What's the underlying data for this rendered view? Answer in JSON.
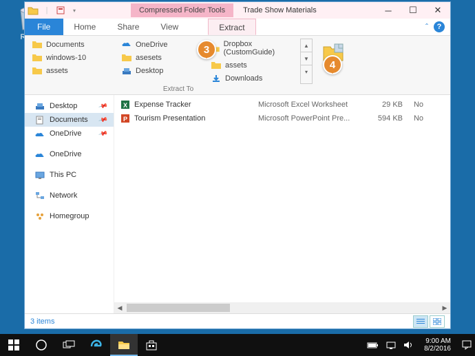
{
  "desktop": {
    "recycle_bin": "Recy"
  },
  "window": {
    "context_title": "Compressed Folder Tools",
    "title": "Trade Show Materials",
    "tabs": {
      "file": "File",
      "home": "Home",
      "share": "Share",
      "view": "View",
      "extract": "Extract"
    },
    "ribbon": {
      "destinations": [
        [
          "Documents",
          "windows-10",
          "assets"
        ],
        [
          "OneDrive",
          "asesets",
          "Desktop"
        ],
        [
          "Dropbox (CustomGuide)",
          "assets",
          "Downloads"
        ]
      ],
      "group_label": "Extract To"
    },
    "callouts": {
      "c3": "3",
      "c4": "4"
    },
    "nav": {
      "quick": [
        {
          "label": "Desktop",
          "icon": "desktop"
        },
        {
          "label": "Documents",
          "icon": "documents",
          "selected": true
        },
        {
          "label": "OneDrive",
          "icon": "onedrive"
        }
      ],
      "main": [
        {
          "label": "OneDrive",
          "icon": "onedrive"
        },
        {
          "label": "This PC",
          "icon": "thispc"
        },
        {
          "label": "Network",
          "icon": "network"
        },
        {
          "label": "Homegroup",
          "icon": "homegroup"
        }
      ]
    },
    "files": [
      {
        "name": "Expense Tracker",
        "type": "Microsoft Excel Worksheet",
        "size": "29 KB",
        "enc": "No",
        "icon": "excel"
      },
      {
        "name": "Tourism Presentation",
        "type": "Microsoft PowerPoint Pre...",
        "size": "594 KB",
        "enc": "No",
        "icon": "ppt"
      }
    ],
    "status": "3 items"
  },
  "taskbar": {
    "time": "9:00 AM",
    "date": "8/2/2016"
  }
}
